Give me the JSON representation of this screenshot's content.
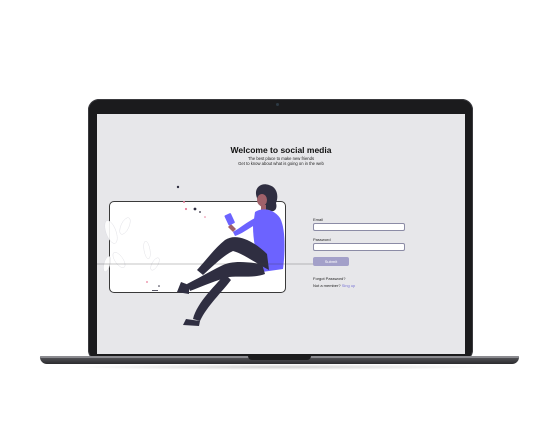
{
  "page": {
    "title": "Welcome to social media",
    "subtitle_line1": "The best place to make new friends",
    "subtitle_line2": "Get to know about what is going on in the web"
  },
  "login_form": {
    "email_label": "Email",
    "email_value": "",
    "password_label": "Password",
    "password_value": "",
    "submit_label": "Submit",
    "forgot_password": "Forgot Password?",
    "not_member": "Not a member?",
    "signup_link": "Sing up"
  },
  "colors": {
    "accent": "#7b76d6",
    "button": "#a3a0c9",
    "figure_shirt": "#6c63ff",
    "figure_pants": "#2f2e41",
    "screen_bg": "#e7e7ea"
  },
  "icons": {
    "illustration": "person-sitting-with-phone-illustration"
  }
}
